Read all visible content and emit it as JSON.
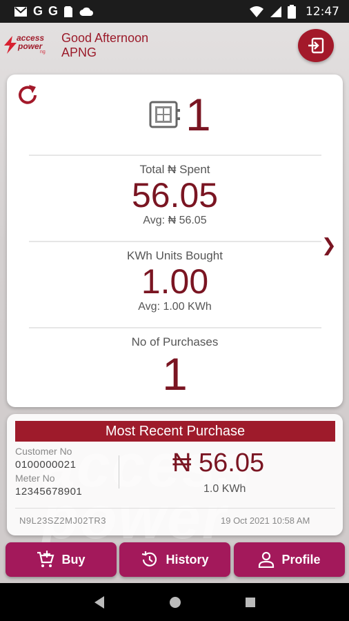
{
  "status_bar": {
    "time": "12:47",
    "g1": "G",
    "g2": "G"
  },
  "header": {
    "logo_line1": "access",
    "logo_line2": "power",
    "logo_suffix": "ng",
    "greeting": "Good Afternoon",
    "username": "APNG"
  },
  "stats": {
    "meter_count": "1",
    "total_spent_label": "Total ₦ Spent",
    "total_spent_value": "56.05",
    "total_spent_avg": "Avg:  ₦ 56.05",
    "kwh_label": "KWh Units Bought",
    "kwh_value": "1.00",
    "kwh_avg": "Avg:  1.00 KWh",
    "purchases_label": "No of Purchases",
    "purchases_value": "1"
  },
  "recent": {
    "title": "Most Recent Purchase",
    "customer_label": "Customer No",
    "customer_no": "0100000021",
    "meter_label": "Meter No",
    "meter_no": "12345678901",
    "amount": "₦ 56.05",
    "kwh": "1.0 KWh",
    "reference": "N9L23SZ2MJ02TR3",
    "date": "19 Oct 2021 10:58 AM"
  },
  "nav": {
    "buy": "Buy",
    "history": "History",
    "profile": "Profile"
  },
  "colors": {
    "brand": "#a3192a",
    "nav": "#a3195b",
    "text_dark_red": "#7a1522"
  }
}
